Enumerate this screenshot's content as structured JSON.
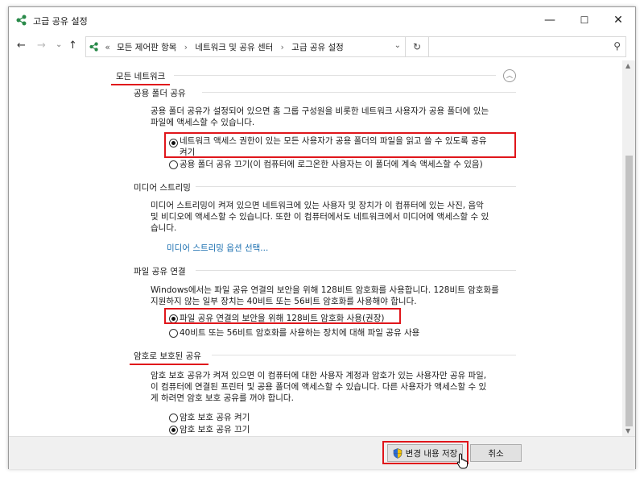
{
  "window": {
    "title": "고급 공유 설정",
    "minimize": "—",
    "maximize": "☐",
    "close": "✕"
  },
  "nav": {
    "back": "←",
    "forward": "→",
    "history": "⌄",
    "up": "↑",
    "crumb_prefix": "«",
    "breadcrumb": [
      "모든 제어판 항목",
      "네트워크 및 공유 센터",
      "고급 공유 설정"
    ],
    "separator": "›",
    "dropdown": "⌄",
    "refresh": "↻",
    "search_placeholder": "",
    "search_icon": "⚲"
  },
  "network_profile": "모든 네트워크",
  "public_folder": {
    "heading": "공용 폴더 공유",
    "desc": [
      "공용 폴더 공유가 설정되어 있으면 홈 그룹 구성원을 비롯한 네트워크 사용자가 공용 폴더에 있는",
      "파일에 액세스할 수 있습니다."
    ],
    "option_on": [
      "네트워크 액세스 권한이 있는 모든 사용자가 공용 폴더의 파일을 읽고 쓸 수 있도록 공유",
      "켜기"
    ],
    "option_off": "공용 폴더 공유 끄기(이 컴퓨터에 로그온한 사용자는 이 폴더에 계속 액세스할 수 있음)"
  },
  "media_streaming": {
    "heading": "미디어 스트리밍",
    "desc": [
      "미디어 스트리밍이 켜져 있으면 네트워크에 있는 사용자 및 장치가 이 컴퓨터에 있는 사진, 음악",
      "및 비디오에 액세스할 수 있습니다. 또한 이 컴퓨터에서도 네트워크에서 미디어에 액세스할 수 있",
      "습니다."
    ],
    "link": "미디어 스트리밍 옵션 선택..."
  },
  "file_sharing": {
    "heading": "파일 공유 연결",
    "desc": [
      "Windows에서는 파일 공유 연결의 보안을 위해 128비트 암호화를 사용합니다. 128비트 암호화를",
      "지원하지 않는 일부 장치는 40비트 또는 56비트 암호화를 사용해야 합니다."
    ],
    "option_128": "파일 공유 연결의 보안을 위해 128비트 암호화 사용(권장)",
    "option_40": "40비트 또는 56비트 암호화를 사용하는 장치에 대해 파일 공유 사용"
  },
  "password_sharing": {
    "heading": "암호로 보호된 공유",
    "desc": [
      "암호 보호 공유가 켜져 있으면 이 컴퓨터에 대한 사용자 계정과 암호가 있는 사용자만 공유 파일,",
      "이 컴퓨터에 연결된 프린터 및 공용 폴더에 액세스할 수 있습니다. 다른 사용자가 액세스할 수 있",
      "게 하려면 암호 보호 공유를 꺼야 합니다."
    ],
    "option_on": "암호 보호 공유 켜기",
    "option_off": "암호 보호 공유 끄기"
  },
  "footer": {
    "save": "변경 내용 저장",
    "cancel": "취소"
  },
  "colors": {
    "highlight": "#e0161b",
    "link": "#1a6fb0"
  }
}
